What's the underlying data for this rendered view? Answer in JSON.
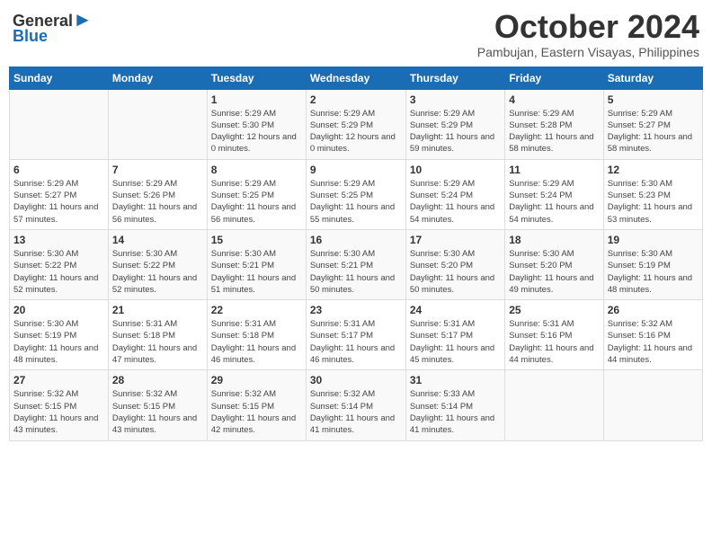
{
  "header": {
    "logo_line1": "General",
    "logo_line2": "Blue",
    "month": "October 2024",
    "location": "Pambujan, Eastern Visayas, Philippines"
  },
  "days_of_week": [
    "Sunday",
    "Monday",
    "Tuesday",
    "Wednesday",
    "Thursday",
    "Friday",
    "Saturday"
  ],
  "weeks": [
    [
      {
        "day": "",
        "sunrise": "",
        "sunset": "",
        "daylight": ""
      },
      {
        "day": "",
        "sunrise": "",
        "sunset": "",
        "daylight": ""
      },
      {
        "day": "1",
        "sunrise": "Sunrise: 5:29 AM",
        "sunset": "Sunset: 5:30 PM",
        "daylight": "Daylight: 12 hours and 0 minutes."
      },
      {
        "day": "2",
        "sunrise": "Sunrise: 5:29 AM",
        "sunset": "Sunset: 5:29 PM",
        "daylight": "Daylight: 12 hours and 0 minutes."
      },
      {
        "day": "3",
        "sunrise": "Sunrise: 5:29 AM",
        "sunset": "Sunset: 5:29 PM",
        "daylight": "Daylight: 11 hours and 59 minutes."
      },
      {
        "day": "4",
        "sunrise": "Sunrise: 5:29 AM",
        "sunset": "Sunset: 5:28 PM",
        "daylight": "Daylight: 11 hours and 58 minutes."
      },
      {
        "day": "5",
        "sunrise": "Sunrise: 5:29 AM",
        "sunset": "Sunset: 5:27 PM",
        "daylight": "Daylight: 11 hours and 58 minutes."
      }
    ],
    [
      {
        "day": "6",
        "sunrise": "Sunrise: 5:29 AM",
        "sunset": "Sunset: 5:27 PM",
        "daylight": "Daylight: 11 hours and 57 minutes."
      },
      {
        "day": "7",
        "sunrise": "Sunrise: 5:29 AM",
        "sunset": "Sunset: 5:26 PM",
        "daylight": "Daylight: 11 hours and 56 minutes."
      },
      {
        "day": "8",
        "sunrise": "Sunrise: 5:29 AM",
        "sunset": "Sunset: 5:25 PM",
        "daylight": "Daylight: 11 hours and 56 minutes."
      },
      {
        "day": "9",
        "sunrise": "Sunrise: 5:29 AM",
        "sunset": "Sunset: 5:25 PM",
        "daylight": "Daylight: 11 hours and 55 minutes."
      },
      {
        "day": "10",
        "sunrise": "Sunrise: 5:29 AM",
        "sunset": "Sunset: 5:24 PM",
        "daylight": "Daylight: 11 hours and 54 minutes."
      },
      {
        "day": "11",
        "sunrise": "Sunrise: 5:29 AM",
        "sunset": "Sunset: 5:24 PM",
        "daylight": "Daylight: 11 hours and 54 minutes."
      },
      {
        "day": "12",
        "sunrise": "Sunrise: 5:30 AM",
        "sunset": "Sunset: 5:23 PM",
        "daylight": "Daylight: 11 hours and 53 minutes."
      }
    ],
    [
      {
        "day": "13",
        "sunrise": "Sunrise: 5:30 AM",
        "sunset": "Sunset: 5:22 PM",
        "daylight": "Daylight: 11 hours and 52 minutes."
      },
      {
        "day": "14",
        "sunrise": "Sunrise: 5:30 AM",
        "sunset": "Sunset: 5:22 PM",
        "daylight": "Daylight: 11 hours and 52 minutes."
      },
      {
        "day": "15",
        "sunrise": "Sunrise: 5:30 AM",
        "sunset": "Sunset: 5:21 PM",
        "daylight": "Daylight: 11 hours and 51 minutes."
      },
      {
        "day": "16",
        "sunrise": "Sunrise: 5:30 AM",
        "sunset": "Sunset: 5:21 PM",
        "daylight": "Daylight: 11 hours and 50 minutes."
      },
      {
        "day": "17",
        "sunrise": "Sunrise: 5:30 AM",
        "sunset": "Sunset: 5:20 PM",
        "daylight": "Daylight: 11 hours and 50 minutes."
      },
      {
        "day": "18",
        "sunrise": "Sunrise: 5:30 AM",
        "sunset": "Sunset: 5:20 PM",
        "daylight": "Daylight: 11 hours and 49 minutes."
      },
      {
        "day": "19",
        "sunrise": "Sunrise: 5:30 AM",
        "sunset": "Sunset: 5:19 PM",
        "daylight": "Daylight: 11 hours and 48 minutes."
      }
    ],
    [
      {
        "day": "20",
        "sunrise": "Sunrise: 5:30 AM",
        "sunset": "Sunset: 5:19 PM",
        "daylight": "Daylight: 11 hours and 48 minutes."
      },
      {
        "day": "21",
        "sunrise": "Sunrise: 5:31 AM",
        "sunset": "Sunset: 5:18 PM",
        "daylight": "Daylight: 11 hours and 47 minutes."
      },
      {
        "day": "22",
        "sunrise": "Sunrise: 5:31 AM",
        "sunset": "Sunset: 5:18 PM",
        "daylight": "Daylight: 11 hours and 46 minutes."
      },
      {
        "day": "23",
        "sunrise": "Sunrise: 5:31 AM",
        "sunset": "Sunset: 5:17 PM",
        "daylight": "Daylight: 11 hours and 46 minutes."
      },
      {
        "day": "24",
        "sunrise": "Sunrise: 5:31 AM",
        "sunset": "Sunset: 5:17 PM",
        "daylight": "Daylight: 11 hours and 45 minutes."
      },
      {
        "day": "25",
        "sunrise": "Sunrise: 5:31 AM",
        "sunset": "Sunset: 5:16 PM",
        "daylight": "Daylight: 11 hours and 44 minutes."
      },
      {
        "day": "26",
        "sunrise": "Sunrise: 5:32 AM",
        "sunset": "Sunset: 5:16 PM",
        "daylight": "Daylight: 11 hours and 44 minutes."
      }
    ],
    [
      {
        "day": "27",
        "sunrise": "Sunrise: 5:32 AM",
        "sunset": "Sunset: 5:15 PM",
        "daylight": "Daylight: 11 hours and 43 minutes."
      },
      {
        "day": "28",
        "sunrise": "Sunrise: 5:32 AM",
        "sunset": "Sunset: 5:15 PM",
        "daylight": "Daylight: 11 hours and 43 minutes."
      },
      {
        "day": "29",
        "sunrise": "Sunrise: 5:32 AM",
        "sunset": "Sunset: 5:15 PM",
        "daylight": "Daylight: 11 hours and 42 minutes."
      },
      {
        "day": "30",
        "sunrise": "Sunrise: 5:32 AM",
        "sunset": "Sunset: 5:14 PM",
        "daylight": "Daylight: 11 hours and 41 minutes."
      },
      {
        "day": "31",
        "sunrise": "Sunrise: 5:33 AM",
        "sunset": "Sunset: 5:14 PM",
        "daylight": "Daylight: 11 hours and 41 minutes."
      },
      {
        "day": "",
        "sunrise": "",
        "sunset": "",
        "daylight": ""
      },
      {
        "day": "",
        "sunrise": "",
        "sunset": "",
        "daylight": ""
      }
    ]
  ]
}
